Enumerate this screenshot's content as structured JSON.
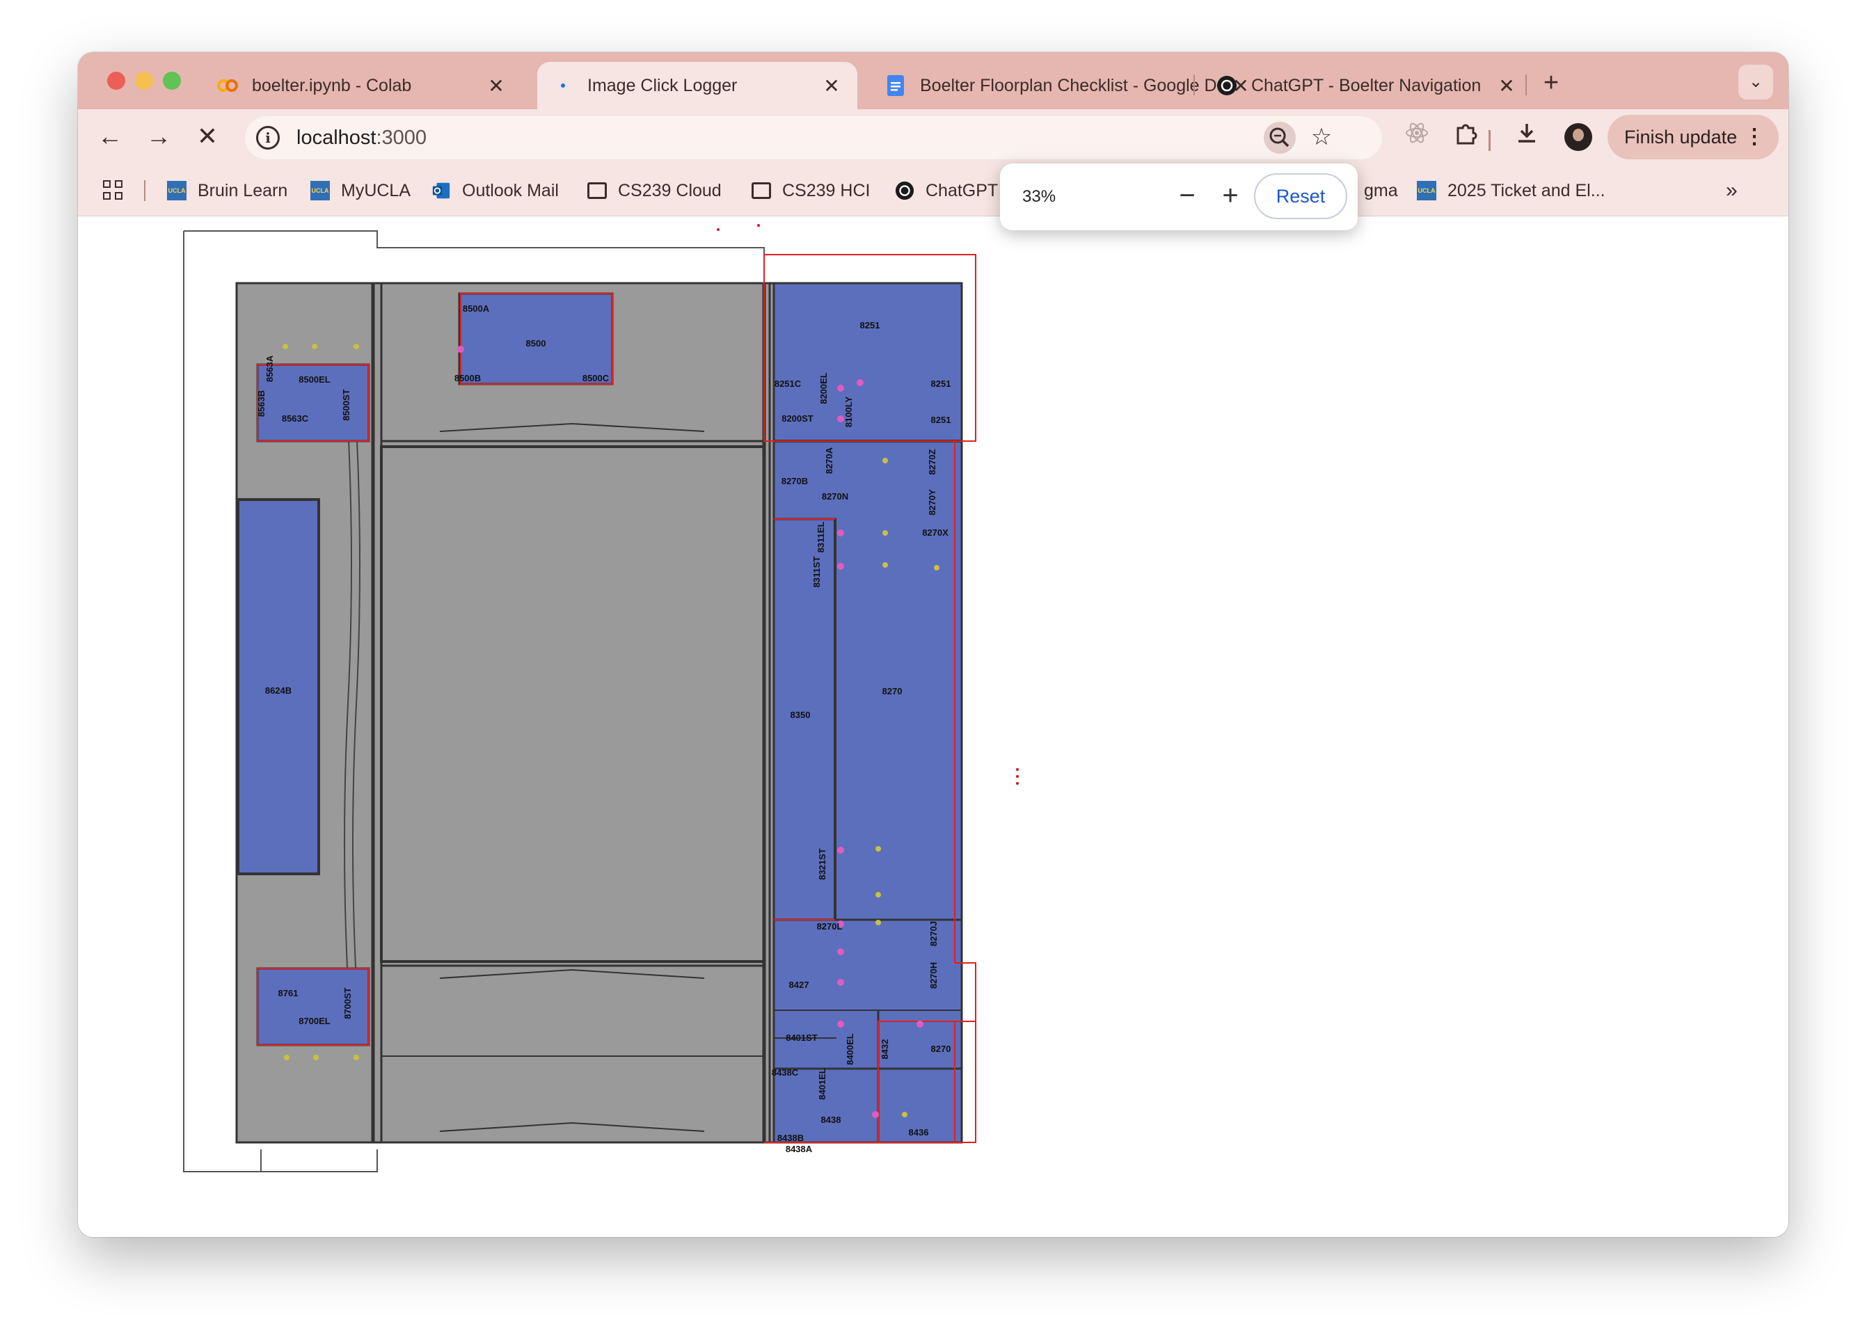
{
  "tabs": [
    {
      "title": "boelter.ipynb - Colab",
      "favicon": "colab-icon"
    },
    {
      "title": "Image Click Logger",
      "favicon": "loading-icon"
    },
    {
      "title": "Boelter Floorplan Checklist - Google Docs",
      "favicon": "docs-icon"
    },
    {
      "title": "ChatGPT - Boelter Navigation",
      "favicon": "chatgpt-icon"
    }
  ],
  "address": {
    "host": "localhost",
    "port": ":3000"
  },
  "finish_update": "Finish update",
  "bookmarks": [
    {
      "label": "Bruin Learn",
      "icon": "ucla-icon"
    },
    {
      "label": "MyUCLA",
      "icon": "ucla-icon"
    },
    {
      "label": "Outlook Mail",
      "icon": "outlook-icon"
    },
    {
      "label": "CS239 Cloud",
      "icon": "folder-icon"
    },
    {
      "label": "CS239 HCI",
      "icon": "folder-icon"
    },
    {
      "label": "ChatGPT",
      "icon": "chatgpt-icon"
    },
    {
      "label": "gma",
      "icon": "figma-icon"
    },
    {
      "label": "2025 Ticket and El...",
      "icon": "ucla-icon"
    }
  ],
  "ucla_badge": "UCLA",
  "zoom": {
    "value": "33%",
    "minus": "−",
    "plus": "+",
    "reset": "Reset"
  },
  "floorplan": {
    "rooms": [
      {
        "id": "r8500A",
        "label": "8500A"
      },
      {
        "id": "r8500",
        "label": "8500"
      },
      {
        "id": "r8500B",
        "label": "8500B"
      },
      {
        "id": "r8500C",
        "label": "8500C"
      },
      {
        "id": "r8500EL",
        "label": "8500EL"
      },
      {
        "id": "r8500ST",
        "label": "8500ST"
      },
      {
        "id": "r8563A",
        "label": "8563A"
      },
      {
        "id": "r8563B",
        "label": "8563B"
      },
      {
        "id": "r8563C",
        "label": "8563C"
      },
      {
        "id": "r8624B",
        "label": "8624B"
      },
      {
        "id": "r8761",
        "label": "8761"
      },
      {
        "id": "r8700EL",
        "label": "8700EL"
      },
      {
        "id": "r8700ST",
        "label": "8700ST"
      },
      {
        "id": "r8251",
        "label": "8251"
      },
      {
        "id": "r8251C",
        "label": "8251C"
      },
      {
        "id": "r8200EL",
        "label": "8200EL"
      },
      {
        "id": "r8100LY",
        "label": "8100LY"
      },
      {
        "id": "r8200ST",
        "label": "8200ST"
      },
      {
        "id": "r8270A",
        "label": "8270A"
      },
      {
        "id": "r8270B",
        "label": "8270B"
      },
      {
        "id": "r8270N",
        "label": "8270N"
      },
      {
        "id": "r8270Z",
        "label": "8270Z"
      },
      {
        "id": "r8270Y",
        "label": "8270Y"
      },
      {
        "id": "r8270X",
        "label": "8270X"
      },
      {
        "id": "r8311EL",
        "label": "8311EL"
      },
      {
        "id": "r8311ST",
        "label": "8311ST"
      },
      {
        "id": "r8270",
        "label": "8270"
      },
      {
        "id": "r8350",
        "label": "8350"
      },
      {
        "id": "r8321ST",
        "label": "8321ST"
      },
      {
        "id": "r8270L",
        "label": "8270L"
      },
      {
        "id": "r8270J",
        "label": "8270J"
      },
      {
        "id": "r8270H",
        "label": "8270H"
      },
      {
        "id": "r8427",
        "label": "8427"
      },
      {
        "id": "r8401ST",
        "label": "8401ST"
      },
      {
        "id": "r8400EL",
        "label": "8400EL"
      },
      {
        "id": "r8432",
        "label": "8432"
      },
      {
        "id": "r8438C",
        "label": "8438C"
      },
      {
        "id": "r8401EL",
        "label": "8401EL"
      },
      {
        "id": "r8438",
        "label": "8438"
      },
      {
        "id": "r8436",
        "label": "8436"
      },
      {
        "id": "r8438A",
        "label": "8438A"
      },
      {
        "id": "r8438B",
        "label": "8438B"
      },
      {
        "id": "r8251b",
        "label": "8251"
      },
      {
        "id": "r8251c2",
        "label": "8251"
      },
      {
        "id": "r8270c",
        "label": "8270"
      }
    ]
  },
  "colors": {
    "tab_strip": "#e5b7b0",
    "toolbar": "#f6e5e2",
    "room_fill": "#5b6fbd",
    "corridor": "#9a9a9a",
    "highlight": "#e02020"
  }
}
